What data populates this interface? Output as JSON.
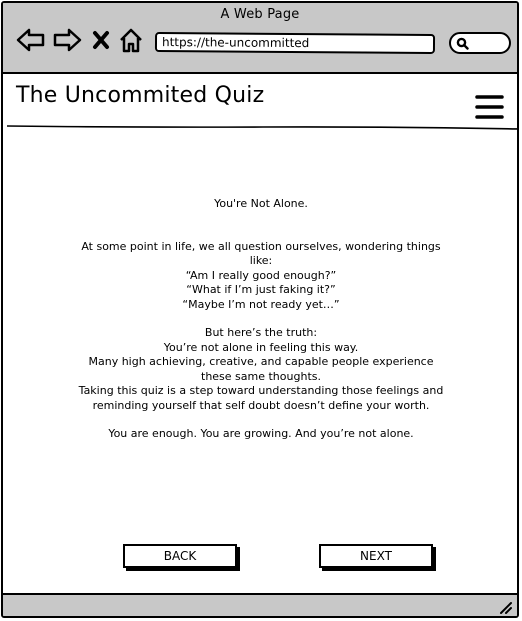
{
  "window": {
    "title": "A Web Page"
  },
  "toolbar": {
    "back_icon": "back-arrow-icon",
    "forward_icon": "forward-arrow-icon",
    "stop_icon": "close-icon",
    "home_icon": "home-icon",
    "address": "https://the-uncommitted",
    "search_icon": "search-icon"
  },
  "header": {
    "title": "The Uncommited Quiz",
    "menu_icon": "hamburger-menu-icon"
  },
  "main": {
    "heading": "You're Not Alone.",
    "intro_line1": "At some point in life, we all question ourselves, wondering things",
    "intro_line2": "like:",
    "quote1": "“Am I really good enough?”",
    "quote2": "“What if I’m just faking it?”",
    "quote3": "“Maybe I’m not ready yet…”",
    "truth_line1": "But here’s the truth:",
    "truth_line2": "You’re not alone in feeling this way.",
    "truth_line3": "Many high achieving, creative, and capable people experience",
    "truth_line4": "these same thoughts.",
    "truth_line5": "Taking this quiz is a step toward understanding those feelings and",
    "truth_line6": "reminding yourself that self doubt doesn’t define your worth.",
    "closing": "You are enough. You are growing. And you’re not alone."
  },
  "buttons": {
    "back_label": "BACK",
    "next_label": "NEXT"
  },
  "colors": {
    "chrome": "#c8c8c8",
    "stroke": "#000000",
    "page": "#ffffff"
  }
}
